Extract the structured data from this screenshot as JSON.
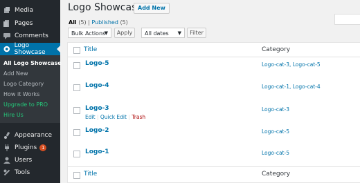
{
  "sidebar": {
    "items": [
      {
        "label": "Media",
        "icon": "media-icon"
      },
      {
        "label": "Pages",
        "icon": "page-icon"
      },
      {
        "label": "Comments",
        "icon": "comment-icon"
      },
      {
        "label": "Logo Showcase",
        "icon": "logo-icon"
      },
      {
        "label": "Appearance",
        "icon": "brush-icon"
      },
      {
        "label": "Plugins",
        "icon": "plug-icon",
        "badge": "1"
      },
      {
        "label": "Users",
        "icon": "user-icon"
      },
      {
        "label": "Tools",
        "icon": "wrench-icon"
      }
    ],
    "submenu": [
      "All Logo Showcase",
      "Add New",
      "Logo Category",
      "How it Works",
      "Upgrade to PRO",
      "Hire Us"
    ]
  },
  "header": {
    "title": "Logo Showcase",
    "add_new": "Add New"
  },
  "views": {
    "all": "All",
    "all_count": "(5)",
    "sep": "|",
    "published": "Published",
    "published_count": "(5)"
  },
  "filters": {
    "bulk": "Bulk Actions",
    "apply": "Apply",
    "dates": "All dates",
    "filter": "Filter"
  },
  "table": {
    "col_title": "Title",
    "col_category": "Category",
    "rows": [
      {
        "title": "Logo-5",
        "category": "Logo-cat-3, Logo-cat-5"
      },
      {
        "title": "Logo-4",
        "category": "Logo-cat-1, Logo-cat-4"
      },
      {
        "title": "Logo-3",
        "category": "Logo-cat-3"
      },
      {
        "title": "Logo-2",
        "category": "Logo-cat-5"
      },
      {
        "title": "Logo-1",
        "category": "Logo-cat-5"
      }
    ],
    "row_actions": {
      "edit": "Edit",
      "quick_edit": "Quick Edit",
      "trash": "Trash",
      "sep": "|"
    }
  },
  "colors": {
    "sidebar": "#23282d",
    "active": "#0073aa",
    "link": "#0073aa",
    "green": "#24c87a",
    "badge": "#d54e21"
  }
}
